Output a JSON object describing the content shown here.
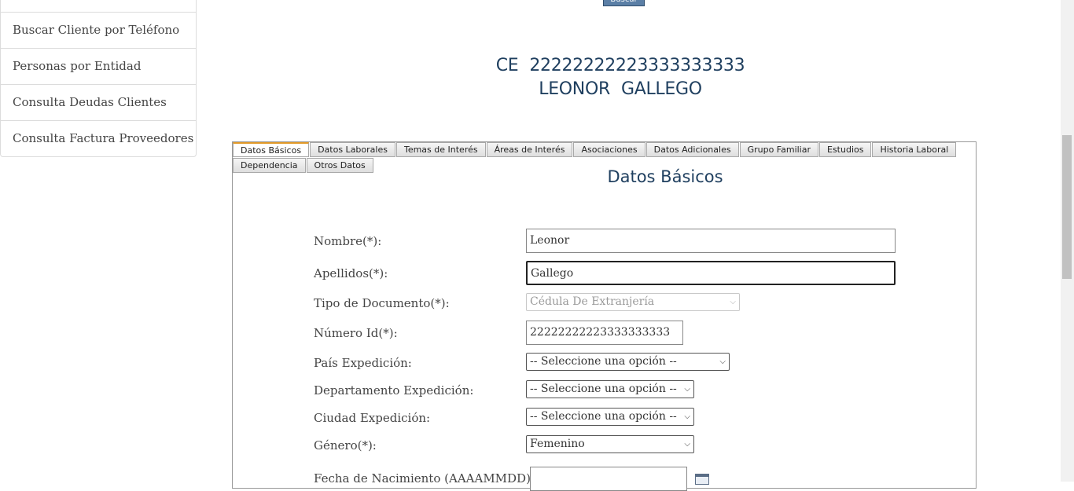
{
  "sidebar": {
    "items": [
      {
        "label": "Buscar Cliente por Teléfono"
      },
      {
        "label": "Personas por Entidad"
      },
      {
        "label": "Consulta Deudas Clientes"
      },
      {
        "label": "Consulta Factura Proveedores"
      }
    ]
  },
  "search_button": {
    "label": "Buscar"
  },
  "header": {
    "doc_type": "CE",
    "doc_number": "22222222223333333333",
    "first_name": "LEONOR",
    "last_name": "GALLEGO"
  },
  "tabs": {
    "row1": [
      "Datos Básicos",
      "Datos Laborales",
      "Temas de Interés",
      "Áreas de Interés",
      "Asociaciones",
      "Datos Adicionales",
      "Grupo Familiar",
      "Estudios",
      "Historia Laboral"
    ],
    "row2": [
      "Dependencia",
      "Otros Datos"
    ],
    "active": "Datos Básicos"
  },
  "panel": {
    "title": "Datos Básicos"
  },
  "form": {
    "nombre": {
      "label": "Nombre(*):",
      "value": "Leonor"
    },
    "apellidos": {
      "label": "Apellidos(*):",
      "value": "Gallego"
    },
    "tipo_documento": {
      "label": "Tipo de Documento(*):",
      "value": "Cédula De Extranjería"
    },
    "numero_id": {
      "label": "Número Id(*):",
      "value": "22222222223333333333"
    },
    "pais": {
      "label": "País Expedición:",
      "value": "-- Seleccione una opción --"
    },
    "departamento": {
      "label": "Departamento Expedición:",
      "value": "-- Seleccione una opción --"
    },
    "ciudad": {
      "label": "Ciudad Expedición:",
      "value": "-- Seleccione una opción --"
    },
    "genero": {
      "label": "Género(*):",
      "value": "Femenino"
    },
    "fecha_nacimiento": {
      "label": "Fecha de Nacimiento (AAAAMMDD):",
      "value": ""
    }
  },
  "icons": {
    "calendar": "calendar-icon",
    "chevron": "chevron-down-icon"
  }
}
